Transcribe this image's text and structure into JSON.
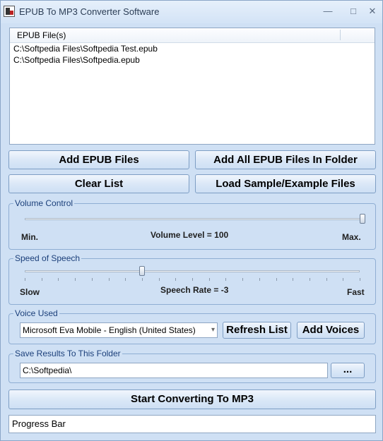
{
  "window": {
    "title": "EPUB To MP3 Converter Software",
    "minimize": "—",
    "maximize": "□",
    "close": "✕"
  },
  "file_list": {
    "column": "EPUB File(s)",
    "rows": [
      "C:\\Softpedia Files\\Softpedia Test.epub",
      "C:\\Softpedia Files\\Softpedia.epub"
    ]
  },
  "buttons": {
    "add_files": "Add EPUB Files",
    "add_folder": "Add All EPUB Files In Folder",
    "clear": "Clear List",
    "load_sample": "Load Sample/Example Files",
    "refresh": "Refresh List",
    "add_voices": "Add Voices",
    "browse": "...",
    "start": "Start Converting To MP3"
  },
  "volume": {
    "legend": "Volume Control",
    "min": "Min.",
    "max": "Max.",
    "level_text": "Volume Level = 100",
    "level_fraction": 1.0
  },
  "speech": {
    "legend": "Speed of Speech",
    "slow": "Slow",
    "fast": "Fast",
    "rate_text": "Speech Rate = -3",
    "rate": -3,
    "range": [
      -10,
      10
    ]
  },
  "voice": {
    "legend": "Voice Used",
    "selected": "Microsoft Eva Mobile - English (United States)"
  },
  "save": {
    "legend": "Save Results To This Folder",
    "path": "C:\\Softpedia\\"
  },
  "progress": {
    "label": "Progress Bar"
  },
  "icons": {
    "app": "app-icon",
    "dropdown": "chevron-down-icon"
  }
}
